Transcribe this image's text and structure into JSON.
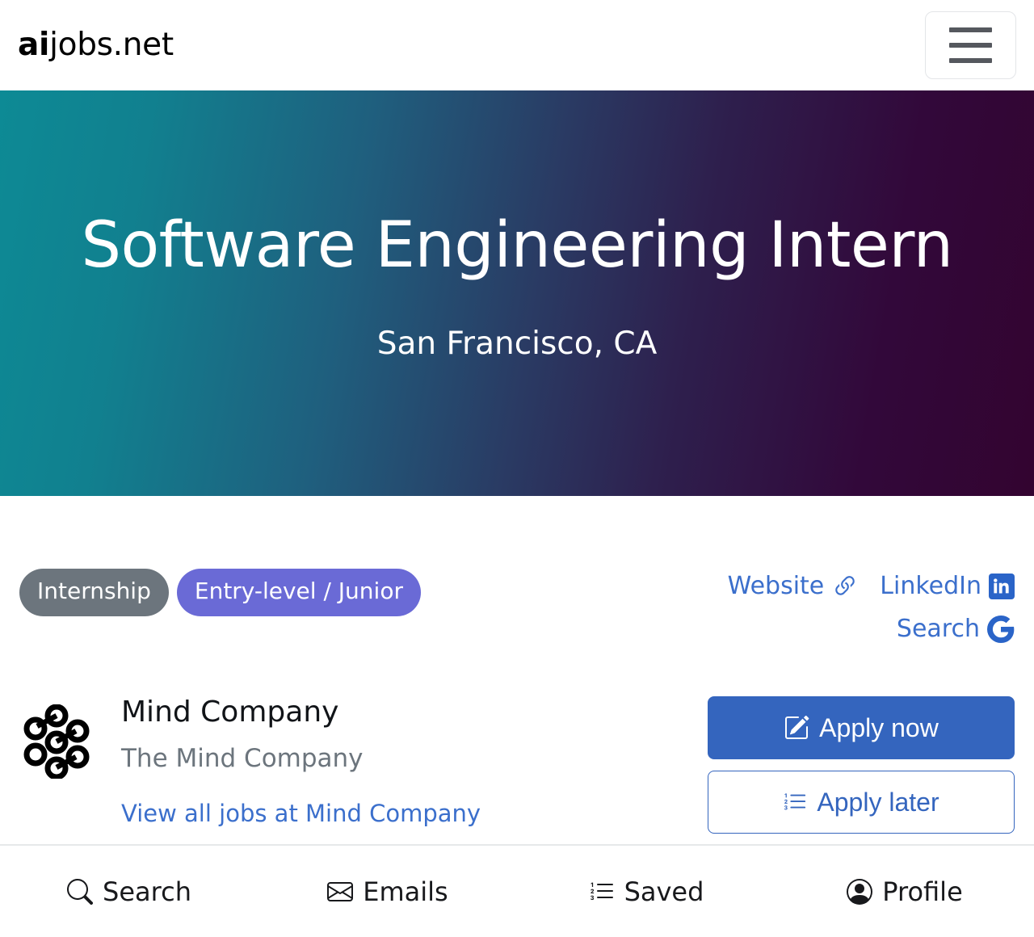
{
  "header": {
    "brand_strong": "ai",
    "brand_rest": "jobs.net",
    "menu_label": "Menu"
  },
  "hero": {
    "title": "Software Engineering Intern",
    "location": "San Francisco, CA",
    "gradient_from": "#0d8a95",
    "gradient_to": "#330430"
  },
  "tags": [
    {
      "label": "Internship",
      "color": "#6c757d"
    },
    {
      "label": "Entry-level / Junior",
      "color": "#6a6ad6"
    }
  ],
  "links": {
    "website": "Website",
    "linkedin": "LinkedIn",
    "search": "Search",
    "color": "#3b6fcc"
  },
  "company": {
    "name": "Mind Company",
    "tagline": "The Mind Company",
    "view_all_jobs": "View all jobs at Mind Company"
  },
  "actions": {
    "apply_now": "Apply now",
    "apply_later": "Apply later",
    "primary_color": "#3465be"
  },
  "bottom_nav": [
    {
      "label": "Search",
      "icon": "search-icon"
    },
    {
      "label": "Emails",
      "icon": "envelope-icon"
    },
    {
      "label": "Saved",
      "icon": "list-ol-icon"
    },
    {
      "label": "Profile",
      "icon": "person-circle-icon"
    }
  ]
}
